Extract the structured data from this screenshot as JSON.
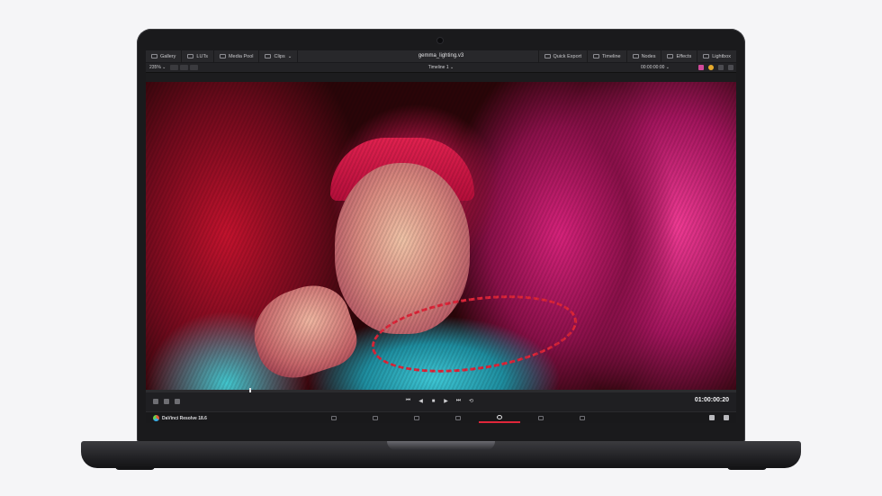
{
  "app": {
    "project_title": "gemma_lighting.v3",
    "brand": "DaVinci Resolve 18.6"
  },
  "topbar": {
    "left": [
      {
        "label": "Gallery"
      },
      {
        "label": "LUTs"
      },
      {
        "label": "Media Pool"
      },
      {
        "label": "Clips"
      }
    ],
    "right": [
      {
        "label": "Quick Export"
      },
      {
        "label": "Timeline"
      },
      {
        "label": "Nodes"
      },
      {
        "label": "Effects"
      },
      {
        "label": "Lightbox"
      }
    ]
  },
  "toolbar": {
    "zoom": "235%",
    "timeline_name": "Timeline 1",
    "timecode": "00:00:00:00"
  },
  "transport": {
    "timecode": "01:00:00:20"
  },
  "colors": {
    "accent": "#e0263a",
    "ui_bg": "#1c1c1e"
  }
}
